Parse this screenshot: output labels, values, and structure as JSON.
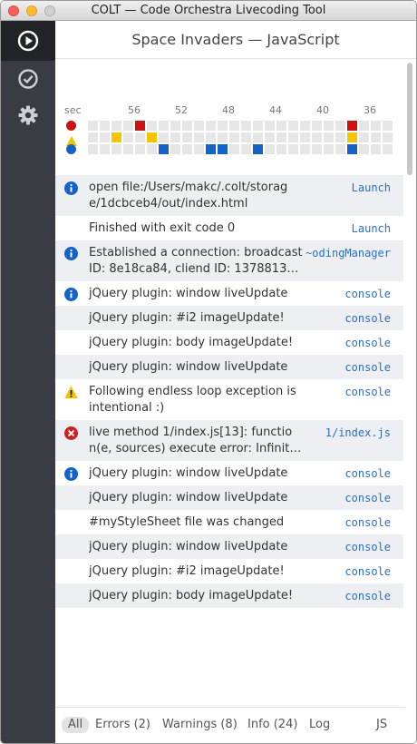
{
  "window": {
    "title": "COLT — Code Orchestra Livecoding Tool"
  },
  "sidebar": {
    "items": [
      {
        "name": "play-icon",
        "active": true
      },
      {
        "name": "check-icon",
        "active": false
      },
      {
        "name": "gear-icon",
        "active": false
      }
    ]
  },
  "header": {
    "title": "Space Invaders — JavaScript"
  },
  "timeline": {
    "unit_label": "sec",
    "ticks": [
      "56",
      "52",
      "48",
      "44",
      "40",
      "36"
    ],
    "tracks": [
      {
        "name": "errors",
        "icon": "error-dot-icon",
        "color": "#cc1111",
        "marked_columns": [
          4,
          22
        ]
      },
      {
        "name": "warnings",
        "icon": "warning-triangle-icon",
        "color": "#f5c400",
        "marked_columns": [
          2,
          5,
          22
        ]
      },
      {
        "name": "info",
        "icon": "info-dot-icon",
        "color": "#1463c8",
        "marked_columns": [
          6,
          10,
          11,
          14,
          22
        ]
      }
    ],
    "column_count": 26
  },
  "log": [
    {
      "icon": "info",
      "message": "open file:/Users/makc/.colt/storag\ne/1dcbceb4/out/index.html",
      "action": "Launch"
    },
    {
      "icon": "",
      "message": "Finished with exit code 0",
      "action": "Launch"
    },
    {
      "icon": "info",
      "message": "Established a connection: broadcast\nID: 8e18ca84, cliend ID: 1378813…",
      "action": "~odingManager"
    },
    {
      "icon": "info",
      "message": "jQuery plugin: window liveUpdate",
      "action": "console"
    },
    {
      "icon": "",
      "message": "jQuery plugin: #i2 imageUpdate!",
      "action": "console"
    },
    {
      "icon": "",
      "message": "jQuery plugin: body imageUpdate!",
      "action": "console"
    },
    {
      "icon": "",
      "message": "jQuery plugin: window liveUpdate",
      "action": "console"
    },
    {
      "icon": "warning",
      "message": "Following endless loop exception is\nintentional :)",
      "action": "console"
    },
    {
      "icon": "error",
      "message": "live method 1/index.js[13]: functio\nn(e, sources) execute error: Infinit…",
      "action": "1/index.js"
    },
    {
      "icon": "info",
      "message": "jQuery plugin: window liveUpdate",
      "action": "console"
    },
    {
      "icon": "",
      "message": "jQuery plugin: window liveUpdate",
      "action": "console"
    },
    {
      "icon": "",
      "message": "#myStyleSheet file was changed",
      "action": "console"
    },
    {
      "icon": "",
      "message": "jQuery plugin: window liveUpdate",
      "action": "console"
    },
    {
      "icon": "",
      "message": "jQuery plugin: #i2 imageUpdate!",
      "action": "console"
    },
    {
      "icon": "",
      "message": "jQuery plugin: body imageUpdate!",
      "action": "console"
    }
  ],
  "footer": {
    "tabs": [
      {
        "label": "All",
        "active": true
      },
      {
        "label": "Errors (2)",
        "active": false
      },
      {
        "label": "Warnings (8)",
        "active": false
      },
      {
        "label": "Info (24)",
        "active": false
      },
      {
        "label": "Log",
        "active": false
      },
      {
        "label": "JS",
        "active": false
      }
    ]
  },
  "colors": {
    "link": "#2a6fbf",
    "sidebar": "#393c42",
    "row_alt": "#edeff3"
  }
}
